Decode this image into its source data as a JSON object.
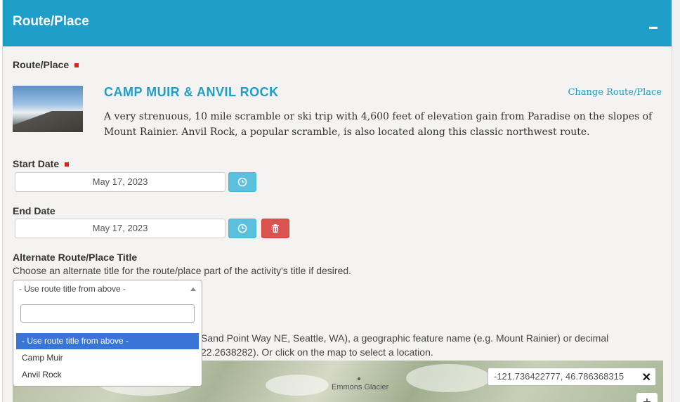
{
  "panel": {
    "title": "Route/Place"
  },
  "route": {
    "label": "Route/Place",
    "title": "CAMP MUIR & ANVIL ROCK",
    "change_link": "Change Route/Place",
    "description": "A very strenuous, 10 mile scramble or ski trip with 4,600 feet of elevation gain from Paradise on the slopes of Mount Rainier. Anvil Rock, a popular scramble, is also located along this classic northwest route."
  },
  "start_date": {
    "label": "Start Date",
    "value": "May 17, 2023"
  },
  "end_date": {
    "label": "End Date",
    "value": "May 17, 2023"
  },
  "alt_title": {
    "label": "Alternate Route/Place Title",
    "help": "Choose an alternate title for the route/place part of the activity's title if desired.",
    "selected": "- Use route title from above -",
    "search_value": "",
    "options": [
      "- Use route title from above -",
      "Camp Muir",
      "Anvil Rock"
    ]
  },
  "location": {
    "help": "Sand Point Way NE, Seattle, WA), a geographic feature name (e.g. Mount Rainier) or decimal 22.2638282). Or click on the map to select a location.",
    "coordinates": "-121.736422777, 46.786368315",
    "map_label": "Emmons Glacier",
    "close_glyph": "✕",
    "zoom_in": "+"
  },
  "colors": {
    "accent": "#1e9ec9",
    "required": "#e0201c",
    "info_button": "#5bc0de",
    "danger_button": "#d9534f",
    "selected_option": "#3875d7"
  },
  "icons": {
    "start_date_button": "clock-icon",
    "end_date_button": "clock-icon",
    "delete_button": "trash-icon",
    "collapse": "minus-icon"
  }
}
